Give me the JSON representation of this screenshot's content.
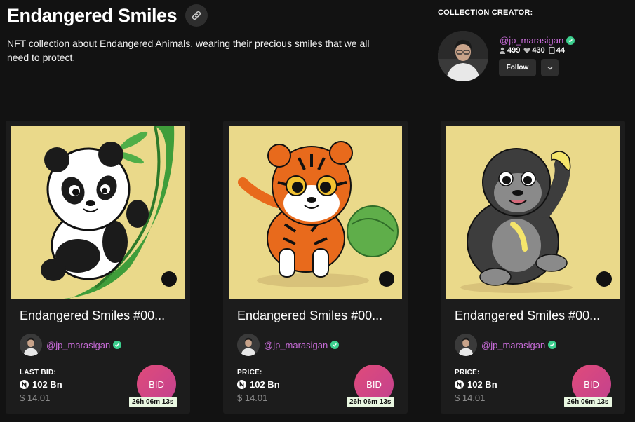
{
  "collection": {
    "title": "Endangered Smiles",
    "description": "NFT collection about Endangered Animals, wearing their precious smiles that we all need to protect."
  },
  "creator": {
    "label": "COLLECTION CREATOR:",
    "handle": "@jp_marasigan",
    "followers": "499",
    "likes": "430",
    "items": "44",
    "follow_label": "Follow"
  },
  "cards": [
    {
      "title": "Endangered Smiles #00...",
      "owner": "@jp_marasigan",
      "price_label": "LAST BID:",
      "price": "102 Bn",
      "usd": "$ 14.01",
      "bid_label": "BID",
      "timer": "26h 06m 13s",
      "animal": "panda"
    },
    {
      "title": "Endangered Smiles #00...",
      "owner": "@jp_marasigan",
      "price_label": "PRICE:",
      "price": "102 Bn",
      "usd": "$ 14.01",
      "bid_label": "BID",
      "timer": "26h 06m 13s",
      "animal": "tiger"
    },
    {
      "title": "Endangered Smiles #00...",
      "owner": "@jp_marasigan",
      "price_label": "PRICE:",
      "price": "102 Bn",
      "usd": "$ 14.01",
      "bid_label": "BID",
      "timer": "26h 06m 13s",
      "animal": "gorilla"
    }
  ],
  "colors": {
    "background": "#121212",
    "card": "#1c1c1c",
    "accent_handle": "#c66bd6",
    "bid_gradient_start": "#e04b7a",
    "bid_gradient_end": "#c2418f",
    "verified": "#3ccf8e",
    "image_bg": "#ead98a"
  }
}
